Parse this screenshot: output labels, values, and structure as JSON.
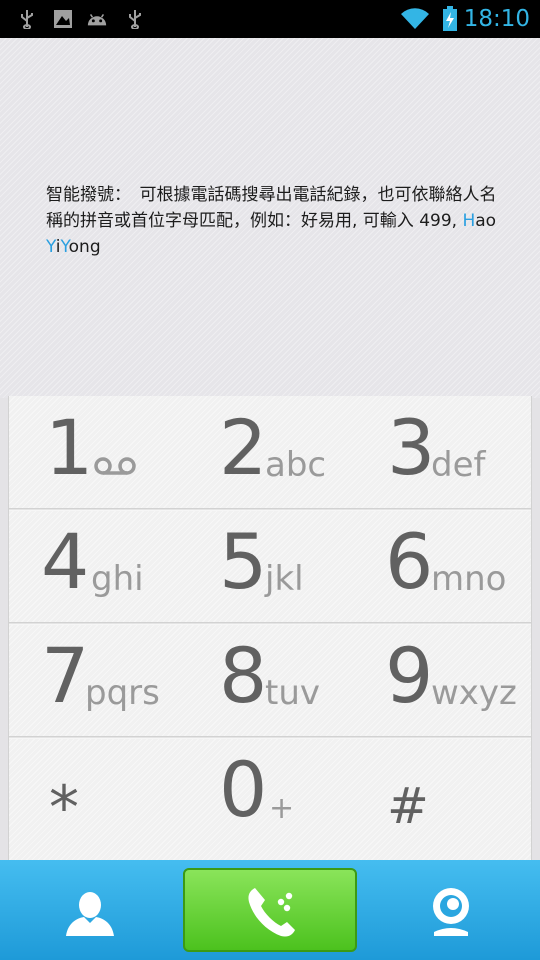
{
  "status_bar": {
    "time": "18:10",
    "icons": [
      "usb-icon",
      "image-icon",
      "android-icon",
      "usb-icon",
      "wifi-icon",
      "battery-charging-icon"
    ]
  },
  "hint": {
    "part1": "智能撥號：　可根據電話碼搜尋出電話紀錄，也可依聯絡人名稱的拼音或首位字母匹配，例如：好易用, 可輸入 499, ",
    "h1": "H",
    "t1": "ao ",
    "h2": "Y",
    "t2": "i",
    "h3": "Y",
    "t3": "ong"
  },
  "keypad": {
    "keys": [
      {
        "digit": "1",
        "letters": "",
        "icon": "voicemail-icon"
      },
      {
        "digit": "2",
        "letters": "abc"
      },
      {
        "digit": "3",
        "letters": "def"
      },
      {
        "digit": "4",
        "letters": "ghi"
      },
      {
        "digit": "5",
        "letters": "jkl"
      },
      {
        "digit": "6",
        "letters": "mno"
      },
      {
        "digit": "7",
        "letters": "pqrs"
      },
      {
        "digit": "8",
        "letters": "tuv"
      },
      {
        "digit": "9",
        "letters": "wxyz"
      },
      {
        "digit": "*",
        "letters": ""
      },
      {
        "digit": "0",
        "letters": "+"
      },
      {
        "digit": "#",
        "letters": ""
      }
    ]
  },
  "bottom_bar": {
    "left_icon": "contacts-icon",
    "center_icon": "phone-icon",
    "right_icon": "video-call-icon"
  },
  "colors": {
    "accent": "#33b5e5",
    "highlight": "#2a9fe0",
    "call_green": "#4cc21e",
    "bar_blue": "#1e9ad8"
  }
}
